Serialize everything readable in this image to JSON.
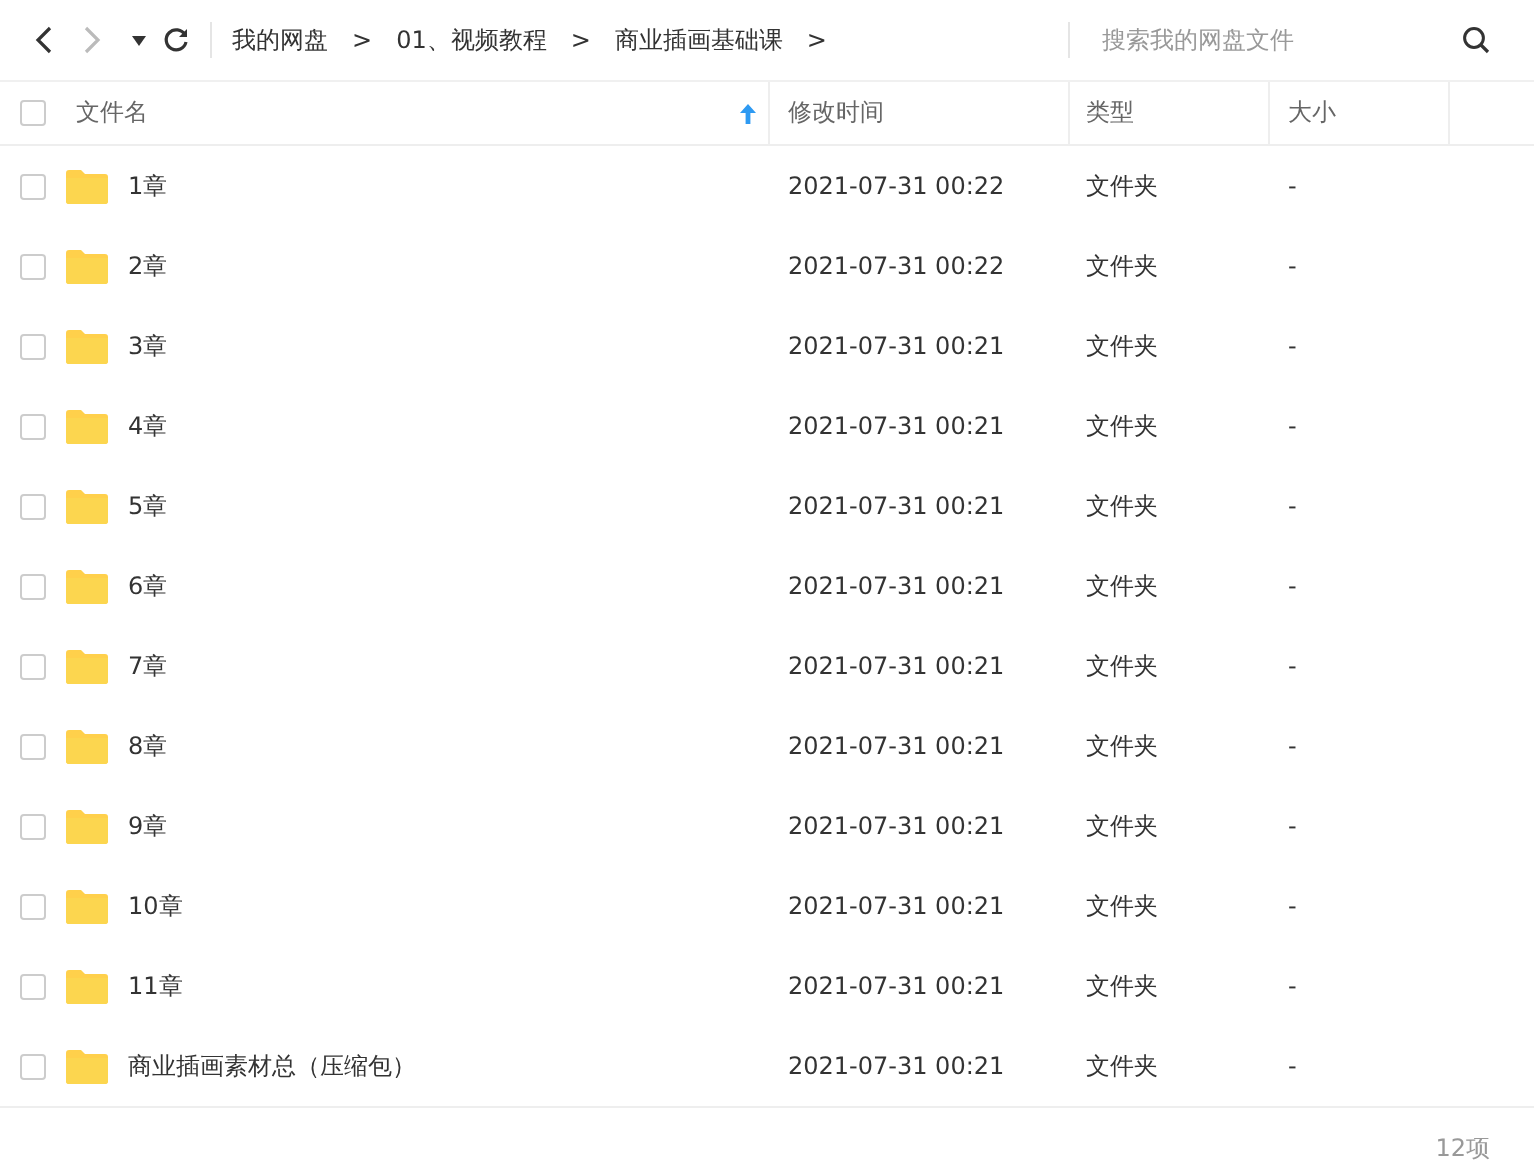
{
  "toolbar": {
    "breadcrumbs": [
      "我的网盘",
      "01、视频教程",
      "商业插画基础课"
    ],
    "separator": ">",
    "search": {
      "placeholder": "搜索我的网盘文件"
    },
    "back_disabled": false,
    "forward_disabled": true
  },
  "table": {
    "select_all": {
      "checked": false
    },
    "columns": [
      {
        "label": "文件名",
        "sorted": true
      },
      {
        "label": "修改时间",
        "sorted": false
      },
      {
        "label": "类型",
        "sorted": false
      },
      {
        "label": "大小",
        "sorted": false
      }
    ],
    "rows": [
      {
        "name": "1章",
        "modified": "2021-07-31 00:22",
        "type": "文件夹",
        "size": "-",
        "checked": false,
        "kind": "folder"
      },
      {
        "name": "2章",
        "modified": "2021-07-31 00:22",
        "type": "文件夹",
        "size": "-",
        "checked": false,
        "kind": "folder"
      },
      {
        "name": "3章",
        "modified": "2021-07-31 00:21",
        "type": "文件夹",
        "size": "-",
        "checked": false,
        "kind": "folder"
      },
      {
        "name": "4章",
        "modified": "2021-07-31 00:21",
        "type": "文件夹",
        "size": "-",
        "checked": false,
        "kind": "folder"
      },
      {
        "name": "5章",
        "modified": "2021-07-31 00:21",
        "type": "文件夹",
        "size": "-",
        "checked": false,
        "kind": "folder"
      },
      {
        "name": "6章",
        "modified": "2021-07-31 00:21",
        "type": "文件夹",
        "size": "-",
        "checked": false,
        "kind": "folder"
      },
      {
        "name": "7章",
        "modified": "2021-07-31 00:21",
        "type": "文件夹",
        "size": "-",
        "checked": false,
        "kind": "folder"
      },
      {
        "name": "8章",
        "modified": "2021-07-31 00:21",
        "type": "文件夹",
        "size": "-",
        "checked": false,
        "kind": "folder"
      },
      {
        "name": "9章",
        "modified": "2021-07-31 00:21",
        "type": "文件夹",
        "size": "-",
        "checked": false,
        "kind": "folder"
      },
      {
        "name": "10章",
        "modified": "2021-07-31 00:21",
        "type": "文件夹",
        "size": "-",
        "checked": false,
        "kind": "folder"
      },
      {
        "name": "11章",
        "modified": "2021-07-31 00:21",
        "type": "文件夹",
        "size": "-",
        "checked": false,
        "kind": "folder"
      },
      {
        "name": "商业插画素材总（压缩包）",
        "modified": "2021-07-31 00:21",
        "type": "文件夹",
        "size": "-",
        "checked": false,
        "kind": "folder"
      }
    ]
  },
  "status_bar": {
    "count": "12项"
  }
}
